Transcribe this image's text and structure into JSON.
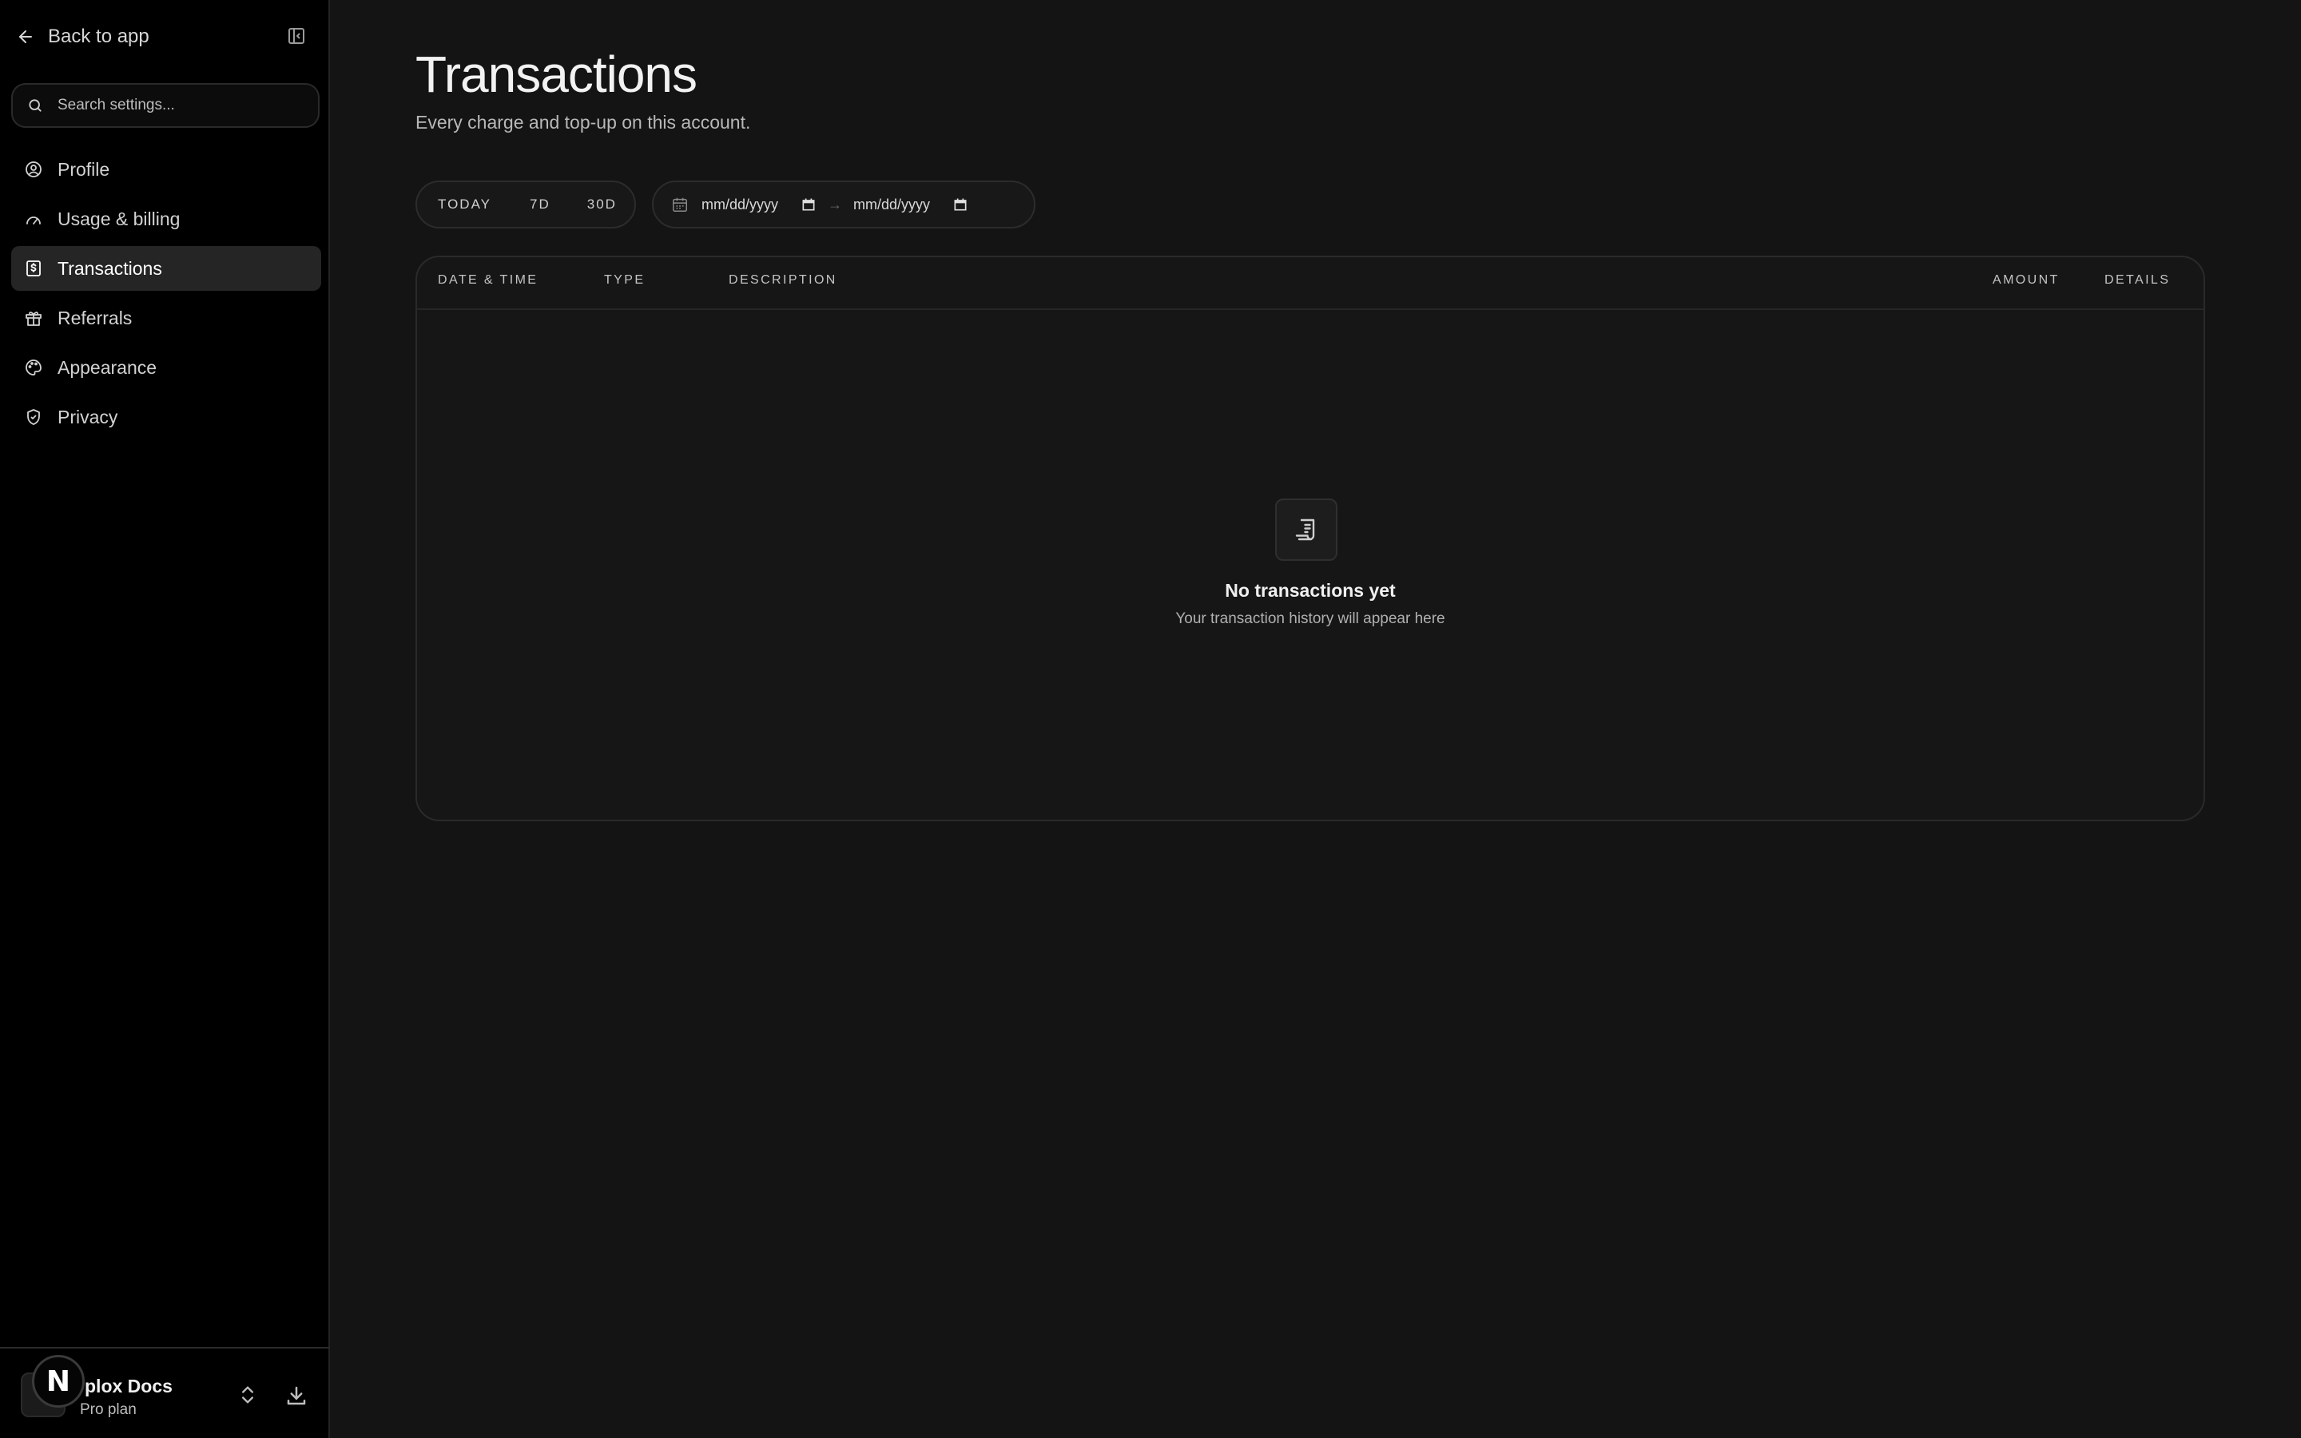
{
  "sidebar": {
    "back_label": "Back to app",
    "search_placeholder": "Search settings...",
    "items": [
      {
        "label": "Profile",
        "icon": "user-circle-icon"
      },
      {
        "label": "Usage & billing",
        "icon": "gauge-icon"
      },
      {
        "label": "Transactions",
        "icon": "dollar-receipt-icon",
        "active": true
      },
      {
        "label": "Referrals",
        "icon": "gift-icon"
      },
      {
        "label": "Appearance",
        "icon": "palette-icon"
      },
      {
        "label": "Privacy",
        "icon": "shield-check-icon"
      }
    ],
    "workspace": {
      "avatar_letter": "N",
      "name": "plox Docs",
      "plan": "Pro plan"
    }
  },
  "main": {
    "title": "Transactions",
    "subtitle": "Every charge and top-up on this account.",
    "range_buttons": [
      "TODAY",
      "7D",
      "30D"
    ],
    "date_from_placeholder": "mm/dd/yyyy",
    "date_to_placeholder": "mm/dd/yyyy",
    "date_separator": "→",
    "table": {
      "columns": [
        "DATE & TIME",
        "TYPE",
        "DESCRIPTION",
        "AMOUNT",
        "DETAILS"
      ],
      "rows": []
    },
    "empty_state": {
      "icon": "receipt-icon",
      "title": "No transactions yet",
      "subtitle": "Your transaction history will appear here"
    }
  },
  "colors": {
    "background": "#141414",
    "sidebar": "#000000",
    "active_item": "#252525"
  }
}
